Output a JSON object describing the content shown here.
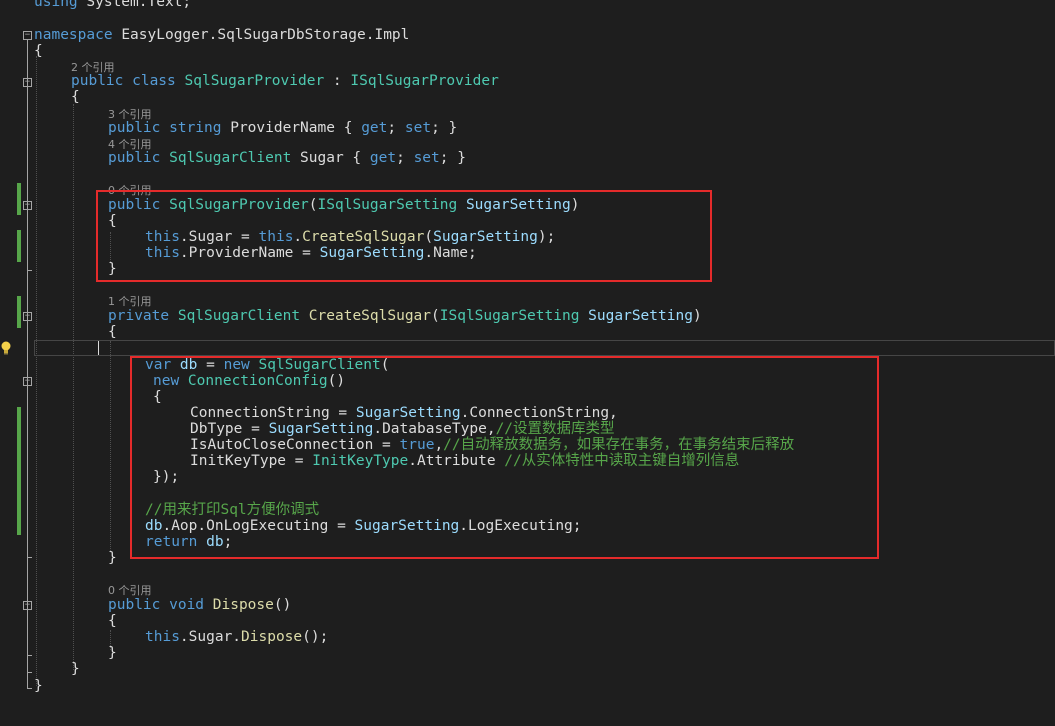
{
  "code": {
    "line_using": [
      "using ",
      "System.Text;"
    ],
    "line_namespace": [
      "namespace ",
      "EasyLogger.SqlSugarDbStorage.Impl"
    ],
    "open_brace": "{",
    "close_brace": "}",
    "class_decl": [
      "public ",
      "class ",
      "SqlSugarProvider",
      " : ",
      "ISqlSugarProvider"
    ],
    "prop_provider_name": [
      "public ",
      "string ",
      "ProviderName",
      " { ",
      "get",
      "; ",
      "set",
      "; }"
    ],
    "prop_sugar": [
      "public ",
      "SqlSugarClient",
      " Sugar { ",
      "get",
      "; ",
      "set",
      "; }"
    ],
    "ctor_decl": [
      "public ",
      "SqlSugarProvider",
      "(",
      "ISqlSugarSetting",
      " ",
      "SugarSetting",
      ")"
    ],
    "ctor_line1": [
      "this",
      ".Sugar = ",
      "this",
      ".",
      "CreateSqlSugar",
      "(",
      "SugarSetting",
      ");"
    ],
    "ctor_line2": [
      "this",
      ".ProviderName = ",
      "SugarSetting",
      ".Name;"
    ],
    "method_decl": [
      "private ",
      "SqlSugarClient",
      " ",
      "CreateSqlSugar",
      "(",
      "ISqlSugarSetting",
      " ",
      "SugarSetting",
      ")"
    ],
    "var_db": [
      "var ",
      "db",
      " = ",
      "new ",
      "SqlSugarClient",
      "("
    ],
    "new_config": [
      "new ",
      "ConnectionConfig",
      "()"
    ],
    "config_open": "{",
    "conn_string": [
      "ConnectionString = ",
      "SugarSetting",
      ".ConnectionString,"
    ],
    "db_type": [
      "DbType = ",
      "SugarSetting",
      ".DatabaseType,",
      "//设置数据库类型"
    ],
    "auto_close": [
      "IsAutoCloseConnection = ",
      "true",
      ",",
      "//自动释放数据务，如果存在事务，在事务结束后释放"
    ],
    "init_key": [
      "InitKeyType = ",
      "InitKeyType",
      ".Attribute ",
      "//从实体特性中读取主键自增列信息"
    ],
    "config_close": "});",
    "comment_log": "//用来打印Sql方便你调式",
    "aop_line": [
      "db",
      ".Aop.OnLogExecuting = ",
      "SugarSetting",
      ".LogExecuting;"
    ],
    "return_line": [
      "return ",
      "db",
      ";"
    ],
    "dispose_decl": [
      "public ",
      "void ",
      "Dispose",
      "()"
    ],
    "dispose_body": [
      "this",
      ".Sugar.",
      "Dispose",
      "();"
    ]
  },
  "codelens": {
    "class_refs": "2 个引用",
    "provider_name_refs": "3 个引用",
    "sugar_refs": "4 个引用",
    "ctor_refs": "0 个引用",
    "create_refs": "1 个引用",
    "dispose_refs": "0 个引用"
  },
  "icons": {
    "fold": "collapse-minus-icon",
    "bulb": "lightbulb-icon"
  },
  "colors": {
    "background": "#1e1e1e",
    "keyword": "#569cd6",
    "type": "#4ec9b0",
    "method": "#dcdcaa",
    "parameter": "#9cdcfe",
    "comment": "#57a64a",
    "text": "#dcdcdc",
    "annotation_box": "#e52b2b",
    "change_bar": "#57a64a"
  }
}
